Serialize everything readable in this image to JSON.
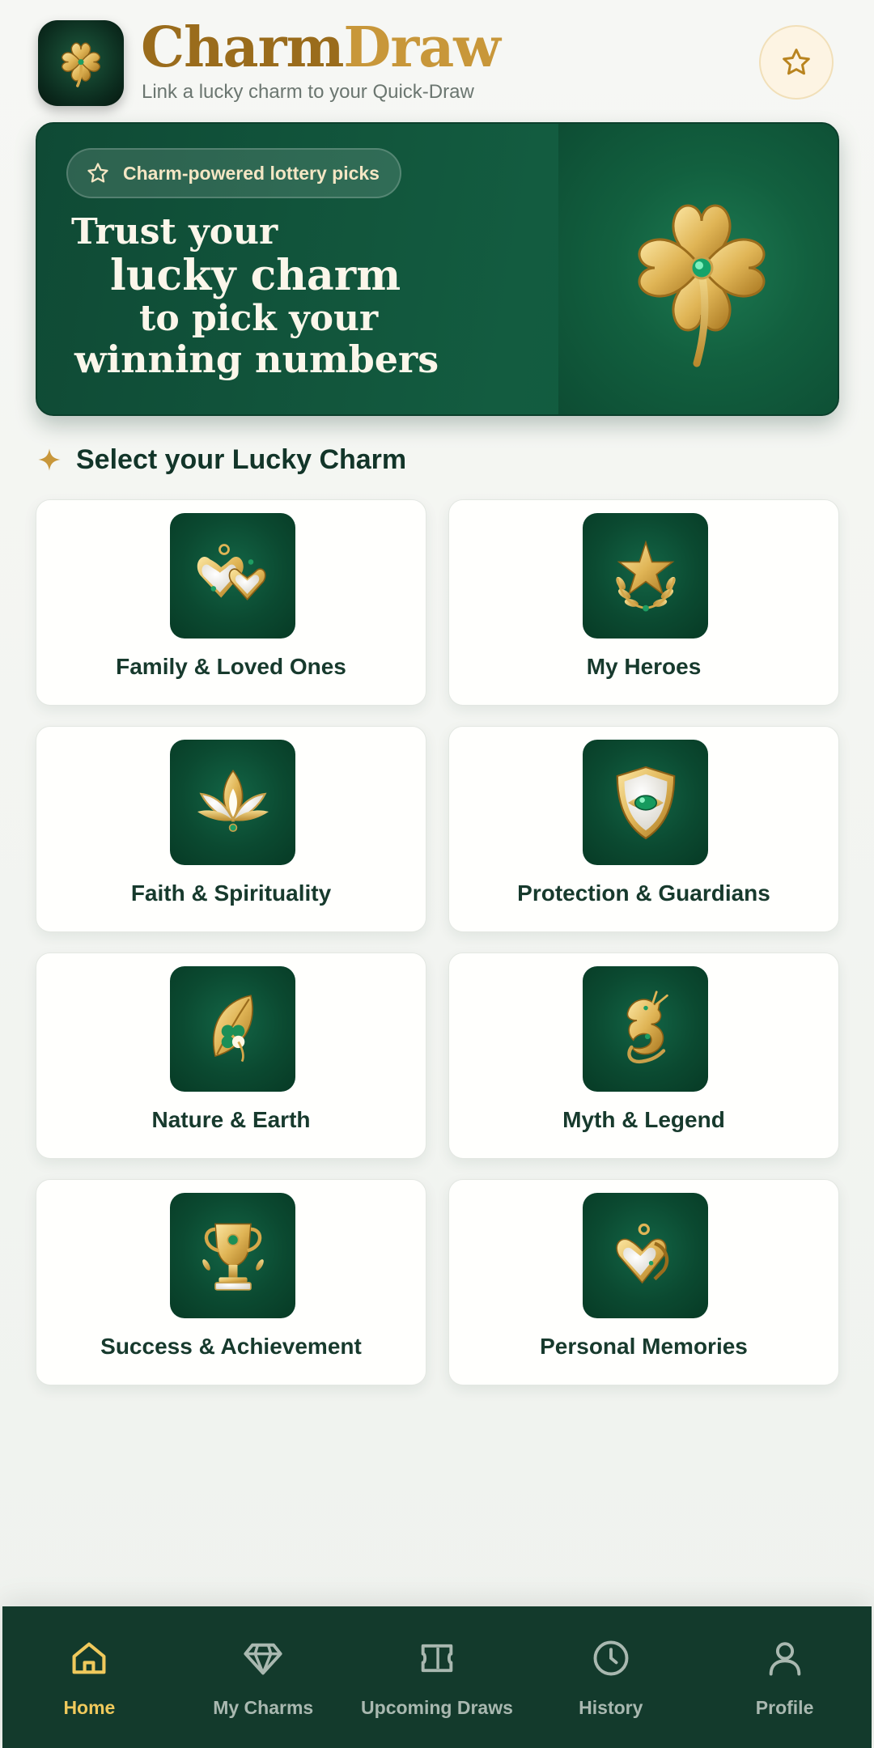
{
  "header": {
    "brand_part1": "Charm",
    "brand_part2": "Draw",
    "tagline": "Link a lucky charm to your Quick-Draw",
    "logo_icon": "clover-icon",
    "favorite_icon": "star-icon"
  },
  "hero": {
    "badge": "Charm-powered lottery picks",
    "headline": [
      "Trust your",
      "lucky charm",
      "to pick your",
      "winning numbers"
    ],
    "art_icon": "gold-clover-icon"
  },
  "section": {
    "title": "Select your Lucky Charm",
    "icon": "sparkle-icon"
  },
  "categories": [
    {
      "label": "Family & Loved Ones",
      "icon": "hearts-icon"
    },
    {
      "label": "My Heroes",
      "icon": "star-laurel-icon"
    },
    {
      "label": "Faith & Spirituality",
      "icon": "lotus-icon"
    },
    {
      "label": "Protection & Guardians",
      "icon": "shield-icon"
    },
    {
      "label": "Nature & Earth",
      "icon": "leaf-clover-icon"
    },
    {
      "label": "Myth & Legend",
      "icon": "dragon-icon"
    },
    {
      "label": "Success & Achievement",
      "icon": "trophy-icon"
    },
    {
      "label": "Personal Memories",
      "icon": "locket-icon"
    }
  ],
  "nav": {
    "items": [
      {
        "label": "Home",
        "icon": "home-icon",
        "active": true
      },
      {
        "label": "My Charms",
        "icon": "diamond-icon",
        "active": false
      },
      {
        "label": "Upcoming Draws",
        "icon": "ticket-icon",
        "active": false
      },
      {
        "label": "History",
        "icon": "clock-icon",
        "active": false
      },
      {
        "label": "Profile",
        "icon": "user-icon",
        "active": false
      }
    ]
  },
  "colors": {
    "brand_green": "#0f4a35",
    "gold": "#c8973a",
    "active_nav": "#f0c95c"
  }
}
